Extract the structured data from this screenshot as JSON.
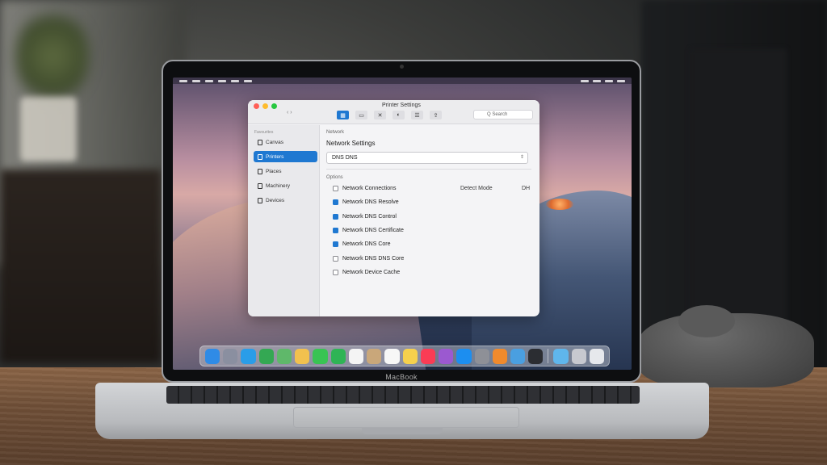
{
  "laptop": {
    "brand_label": "MacBook"
  },
  "window": {
    "title": "Printer Settings",
    "search_placeholder": "Q Search",
    "nav_label": "‹ ›",
    "toolbar": [
      {
        "icon": "network-icon",
        "glyph": "▦",
        "active": true
      },
      {
        "icon": "printer-icon",
        "glyph": "▭",
        "active": false
      },
      {
        "icon": "tools-icon",
        "glyph": "✕",
        "active": false
      },
      {
        "icon": "globe-icon",
        "glyph": "◐",
        "active": false
      },
      {
        "icon": "list-icon",
        "glyph": "☰",
        "active": false
      },
      {
        "icon": "share-icon",
        "glyph": "⇪",
        "active": false
      }
    ]
  },
  "sidebar": {
    "heading": "Favourites",
    "items": [
      {
        "label": "Canvas",
        "selected": false
      },
      {
        "label": "Printers",
        "selected": true
      },
      {
        "label": "Places",
        "selected": false
      },
      {
        "label": "Machinery",
        "selected": false
      },
      {
        "label": "Devices",
        "selected": false
      }
    ]
  },
  "content": {
    "section_label": "Network",
    "heading": "Network Settings",
    "dns_input_value": "DNS DNS",
    "options_label": "Options",
    "options": [
      {
        "label": "Network Connections",
        "checked": false
      },
      {
        "label": "Network DNS Resolve",
        "checked": true
      },
      {
        "label": "Network DNS Control",
        "checked": true
      },
      {
        "label": "Network DNS Certificate",
        "checked": true
      },
      {
        "label": "Network DNS Core",
        "checked": true
      },
      {
        "label": "Network DNS DNS Core",
        "checked": false
      },
      {
        "label": "Network Device Cache",
        "checked": false
      }
    ],
    "row_detail": "Detect Mode",
    "row_tag": "DH"
  },
  "dock": {
    "apps": [
      {
        "icon": "finder-icon",
        "color": "#2f8be6"
      },
      {
        "icon": "launchpad-icon",
        "color": "#8a8fa0"
      },
      {
        "icon": "safari-icon",
        "color": "#2a9de8"
      },
      {
        "icon": "chrome-icon",
        "color": "#34a853"
      },
      {
        "icon": "maps-icon",
        "color": "#5fb86a"
      },
      {
        "icon": "photos-icon",
        "color": "#f2c14e"
      },
      {
        "icon": "messages-icon",
        "color": "#39c453"
      },
      {
        "icon": "facetime-icon",
        "color": "#2fb455"
      },
      {
        "icon": "calendar-icon",
        "color": "#f4f4f4"
      },
      {
        "icon": "contacts-icon",
        "color": "#c9a77a"
      },
      {
        "icon": "reminders-icon",
        "color": "#f7f7f7"
      },
      {
        "icon": "notes-icon",
        "color": "#f6d04d"
      },
      {
        "icon": "music-icon",
        "color": "#fa3c55"
      },
      {
        "icon": "podcasts-icon",
        "color": "#9b59d0"
      },
      {
        "icon": "appstore-icon",
        "color": "#1c8ef0"
      },
      {
        "icon": "settings-icon",
        "color": "#8e9097"
      },
      {
        "icon": "books-icon",
        "color": "#f08a2c"
      },
      {
        "icon": "weather-icon",
        "color": "#4a9fe0"
      },
      {
        "icon": "screenshot-icon",
        "color": "#2b2d32"
      }
    ],
    "trailing": [
      {
        "icon": "folder-icon",
        "color": "#5fb6ec"
      },
      {
        "icon": "downloads-icon",
        "color": "#c7c9cf"
      },
      {
        "icon": "trash-icon",
        "color": "#e6e8ec"
      }
    ]
  }
}
